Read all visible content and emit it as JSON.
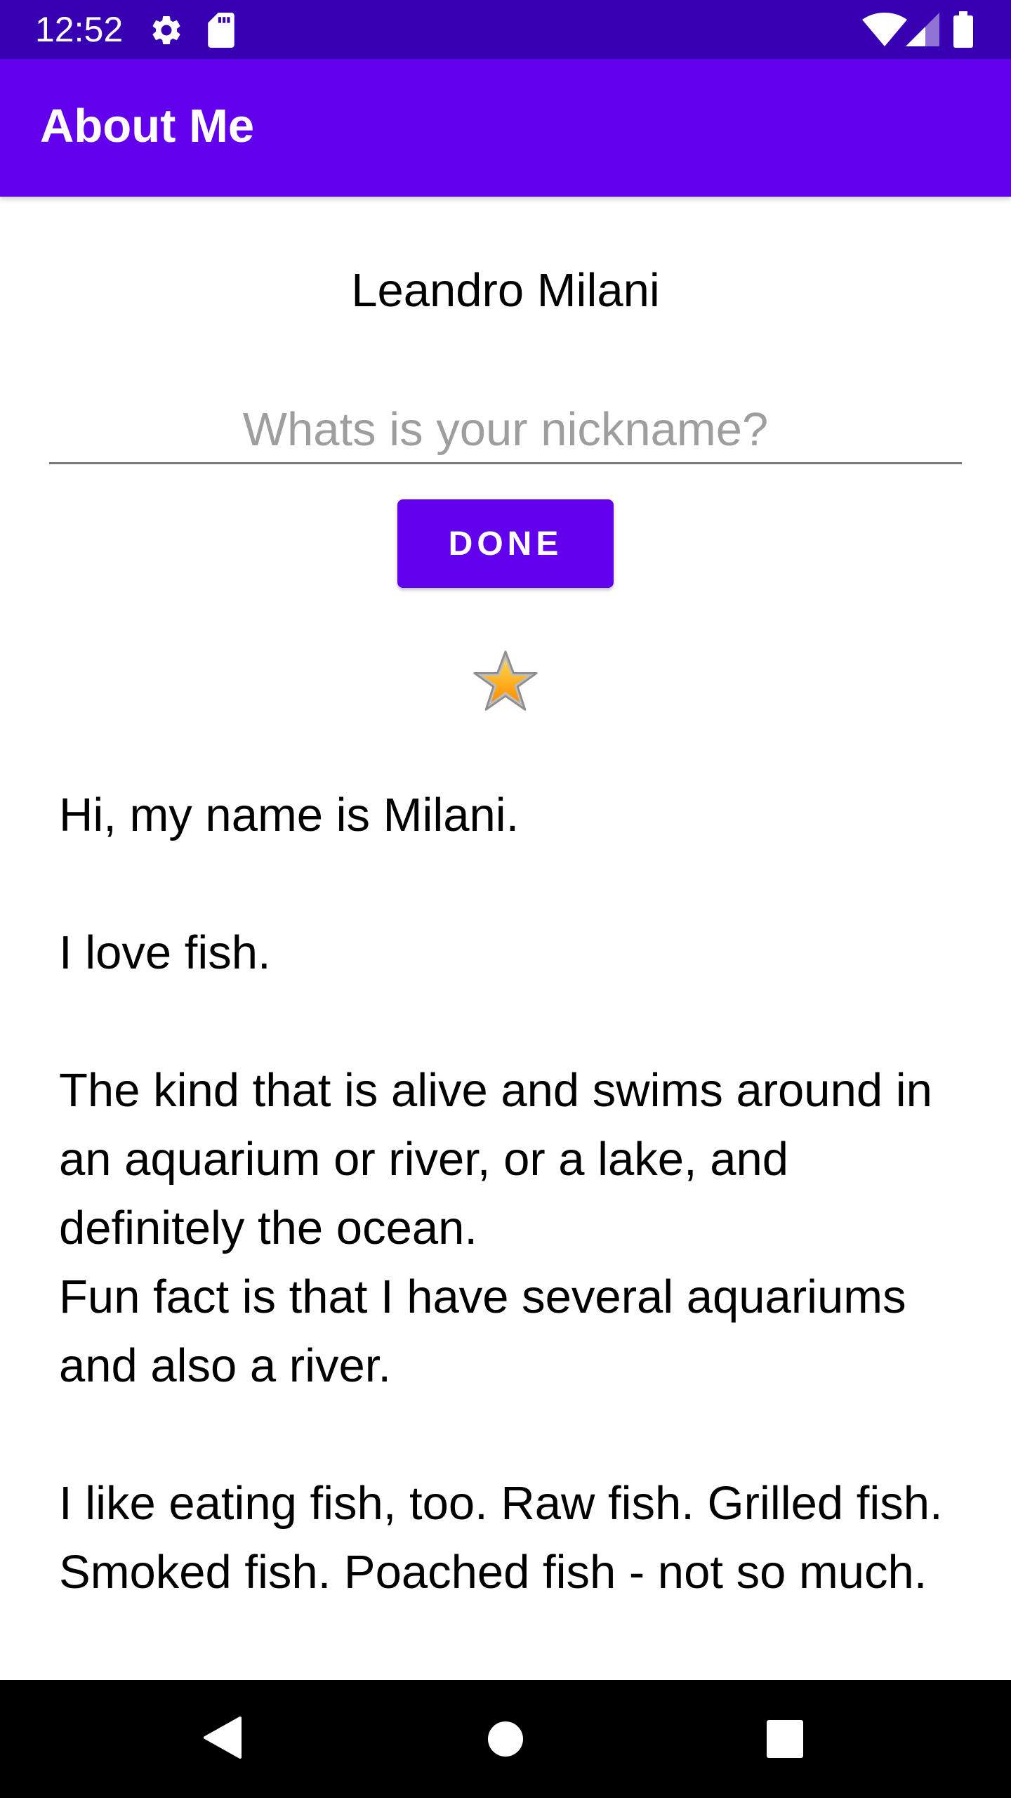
{
  "status_bar": {
    "time": "12:52",
    "icons": [
      "settings-icon",
      "sd-card-icon",
      "wifi-icon",
      "cellular-signal-icon",
      "battery-icon"
    ]
  },
  "app_bar": {
    "title": "About Me"
  },
  "profile": {
    "name": "Leandro Milani",
    "nickname_placeholder": "Whats is your nickname?",
    "nickname_value": "",
    "done_label": "DONE",
    "star_icon": "star-icon"
  },
  "bio": {
    "text": "Hi, my name is Milani.\n\nI love fish.\n\nThe kind that is alive and swims around in an aquarium or river, or a lake, and definitely the ocean.\nFun fact is that I have several aquariums and also a river.\n\nI like eating fish, too. Raw fish. Grilled fish. Smoked fish. Poached fish - not so much."
  },
  "nav_bar": {
    "icons": [
      "back-icon",
      "home-icon",
      "recents-icon"
    ]
  },
  "colors": {
    "status_bar": "#3700B3",
    "primary": "#6200EE",
    "background": "#FFFFFF",
    "nav_bar": "#000000"
  }
}
